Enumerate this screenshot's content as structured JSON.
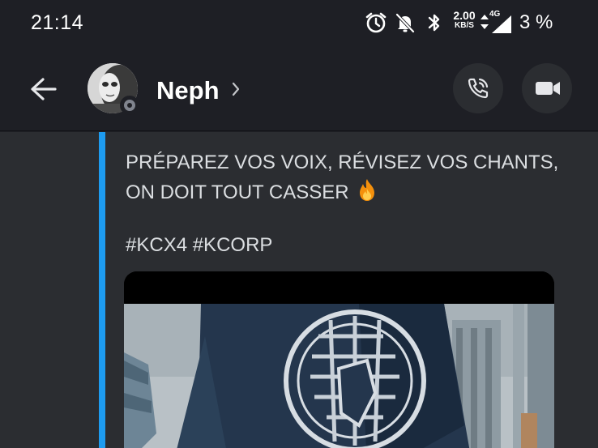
{
  "status_bar": {
    "time": "21:14",
    "net_speed": "2.00",
    "net_speed_unit": "KB/S",
    "net_type": "4G",
    "battery": "3 %",
    "icons": [
      "alarm-icon",
      "mute-notifications-icon",
      "bluetooth-icon",
      "data-arrows-icon",
      "signal-icon"
    ]
  },
  "header": {
    "username": "Neph",
    "back_icon": "arrow-left-icon",
    "chevron_icon": "chevron-right-icon",
    "call_icon": "phone-call-icon",
    "video_icon": "video-camera-icon"
  },
  "message": {
    "embed_lines": [
      "PRÉPAREZ VOS VOIX, RÉVISEZ VOS CHANTS,",
      "ON DOIT TOUT CASSER"
    ],
    "emoji": "fire-emoji",
    "hashtags": "#KCX4 #KCORP"
  },
  "colors": {
    "background": "#1e1f25",
    "content_bg": "#2b2d31",
    "embed_accent": "#1d9bf0",
    "text": "#dbdee1"
  }
}
